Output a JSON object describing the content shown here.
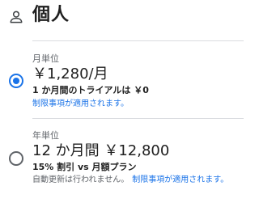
{
  "header": {
    "title": "個人",
    "icon": "person-icon"
  },
  "plans": [
    {
      "period": "月単位",
      "price": "￥1,280/月",
      "detail": "1 か月間のトライアルは ￥0",
      "note": "",
      "link": "制限事項が適用されます。",
      "selected": true
    },
    {
      "period": "年単位",
      "price": "12 か月間 ￥12,800",
      "detail": "15% 割引 vs 月額プラン",
      "note": "自動更新は行われません。",
      "link": "制限事項が適用されます。",
      "selected": false
    }
  ],
  "colors": {
    "accent": "#1a73e8",
    "text": "#1f1f1f",
    "secondary": "#5f6368"
  }
}
